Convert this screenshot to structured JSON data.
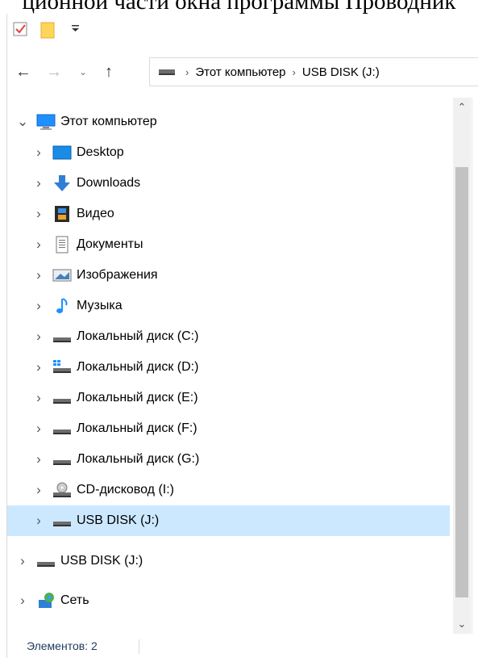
{
  "caption": "ционной части окна программы Проводник",
  "address": {
    "crumbs": [
      "Этот компьютер",
      "USB DISK (J:)"
    ]
  },
  "tree": {
    "root": {
      "label": "Этот компьютер",
      "icon": "computer-icon"
    },
    "items": [
      {
        "label": "Desktop",
        "icon": "desktop-icon"
      },
      {
        "label": "Downloads",
        "icon": "download-icon"
      },
      {
        "label": "Видео",
        "icon": "video-icon"
      },
      {
        "label": "Документы",
        "icon": "documents-icon"
      },
      {
        "label": "Изображения",
        "icon": "pictures-icon"
      },
      {
        "label": "Музыка",
        "icon": "music-icon"
      },
      {
        "label": "Локальный диск (C:)",
        "icon": "drive-icon"
      },
      {
        "label": "Локальный диск (D:)",
        "icon": "system-drive-icon"
      },
      {
        "label": "Локальный диск (E:)",
        "icon": "drive-icon"
      },
      {
        "label": "Локальный диск (F:)",
        "icon": "drive-icon"
      },
      {
        "label": "Локальный диск (G:)",
        "icon": "drive-icon"
      },
      {
        "label": "CD-дисковод (I:)",
        "icon": "cd-drive-icon"
      },
      {
        "label": "USB DISK (J:)",
        "icon": "usb-drive-icon",
        "selected": true
      }
    ],
    "usb_root": {
      "label": "USB DISK (J:)",
      "icon": "usb-drive-icon"
    },
    "network": {
      "label": "Сеть",
      "icon": "network-icon"
    }
  },
  "status": {
    "text": "Элементов: 2"
  },
  "colors": {
    "selection": "#cce8ff",
    "accent": "#1e90ff"
  }
}
